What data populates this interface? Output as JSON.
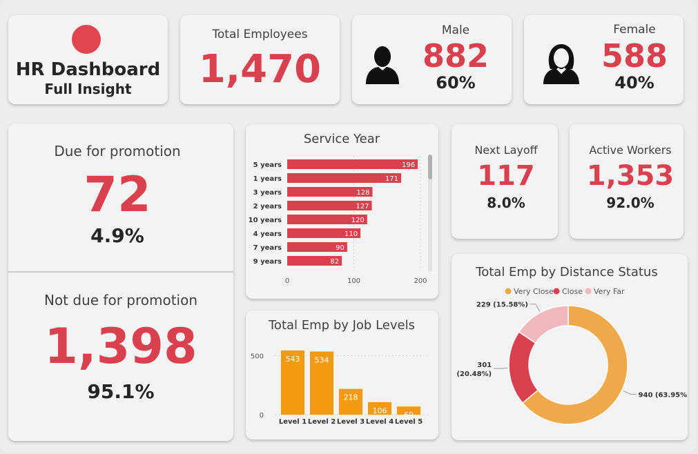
{
  "header": {
    "title": "HR Dashboard",
    "subtitle": "Full Insight",
    "logo_color": "#e04550"
  },
  "kpi": {
    "total_employees": {
      "label": "Total Employees",
      "value": "1,470"
    },
    "male": {
      "label": "Male",
      "value": "882",
      "pct": "60%",
      "icon": "male-person-icon"
    },
    "female": {
      "label": "Female",
      "value": "588",
      "pct": "40%",
      "icon": "female-person-icon"
    },
    "due_promotion": {
      "label": "Due for promotion",
      "value": "72",
      "pct": "4.9%"
    },
    "not_due_promotion": {
      "label": "Not due for promotion",
      "value": "1,398",
      "pct": "95.1%"
    },
    "next_layoff": {
      "label": "Next Layoff",
      "value": "117",
      "pct": "8.0%"
    },
    "active_workers": {
      "label": "Active Workers",
      "value": "1,353",
      "pct": "92.0%"
    }
  },
  "colors": {
    "accent_red": "#d9414f",
    "orange": "#f39a10",
    "very_close": "#f0a94a",
    "close": "#d9414f",
    "very_far": "#f2b7bd"
  },
  "chart_data": [
    {
      "type": "bar",
      "orientation": "horizontal",
      "title": "Service Year",
      "categories": [
        "5 years",
        "1 years",
        "3 years",
        "2 years",
        "10 years",
        "4 years",
        "7 years",
        "9 years"
      ],
      "values": [
        196,
        171,
        128,
        127,
        120,
        110,
        90,
        82
      ],
      "xticks": [
        "0",
        "100",
        "200"
      ],
      "xlim": [
        0,
        200
      ]
    },
    {
      "type": "bar",
      "title": "Total Emp by Job Levels",
      "categories": [
        "Level 1",
        "Level 2",
        "Level 3",
        "Level 4",
        "Level 5"
      ],
      "values": [
        543,
        534,
        218,
        106,
        69
      ],
      "yticks": [
        "0",
        "500"
      ],
      "ylim": [
        0,
        560
      ]
    },
    {
      "type": "pie",
      "donut": true,
      "title": "Total Emp by Distance Status",
      "legend": [
        "Very Close",
        "Close",
        "Very Far"
      ],
      "slices": [
        {
          "name": "Very Close",
          "value": 940,
          "label": "940 (63.95%)"
        },
        {
          "name": "Close",
          "value": 301,
          "label": "301 (20.48%)"
        },
        {
          "name": "Very Far",
          "value": 229,
          "label": "229 (15.58%)"
        }
      ]
    }
  ]
}
